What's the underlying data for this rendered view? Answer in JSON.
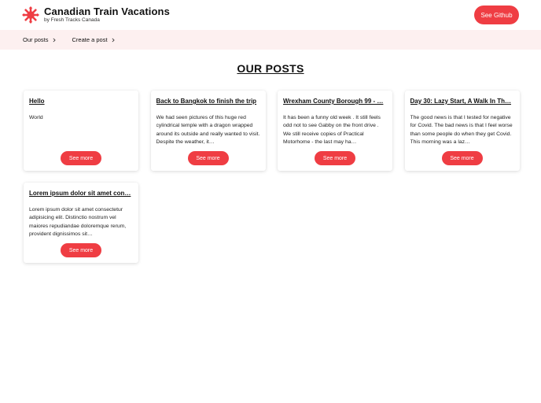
{
  "brand": {
    "title": "Canadian Train Vacations",
    "subtitle": "by Fresh Tracks Canada",
    "logo_icon": "maple-leaf-icon",
    "accent": "#ef3d43"
  },
  "header": {
    "github_label": "See Github"
  },
  "nav": {
    "items": [
      {
        "label": "Our posts",
        "icon": "chevron-right-icon"
      },
      {
        "label": "Create a post",
        "icon": "chevron-right-icon"
      }
    ],
    "background": "#fdf0f0"
  },
  "main": {
    "title": "OUR POSTS",
    "posts": [
      {
        "title": "Hello",
        "excerpt": "World",
        "button": "See more"
      },
      {
        "title": "Back to Bangkok to finish the trip",
        "excerpt": "We had seen pictures of this huge red cylindrical temple with a dragon wrapped around its outside and really wanted to visit. Despite the weather, it…",
        "button": "See more"
      },
      {
        "title": "Wrexham County Borough 99 - …",
        "excerpt": "It has been a funny old week . It still feels odd not to see Gabby on the front drive . We still receive copies of Practical Motorhome - the last may ha…",
        "button": "See more"
      },
      {
        "title": "Day 30: Lazy Start, A Walk In Th…",
        "excerpt": "The good news is that I tested for negative for Covid. The bad news is that I feel worse than some people do when they get Covid. This morning was a laz…",
        "button": "See more"
      },
      {
        "title": "Lorem ipsum dolor sit amet con…",
        "excerpt": "Lorem ipsum dolor sit amet consectetur adipisicing elit. Distinctio nostrum vel maiores repudiandae doloremque rerum, provident dignissimos sit…",
        "button": "See more"
      }
    ]
  }
}
